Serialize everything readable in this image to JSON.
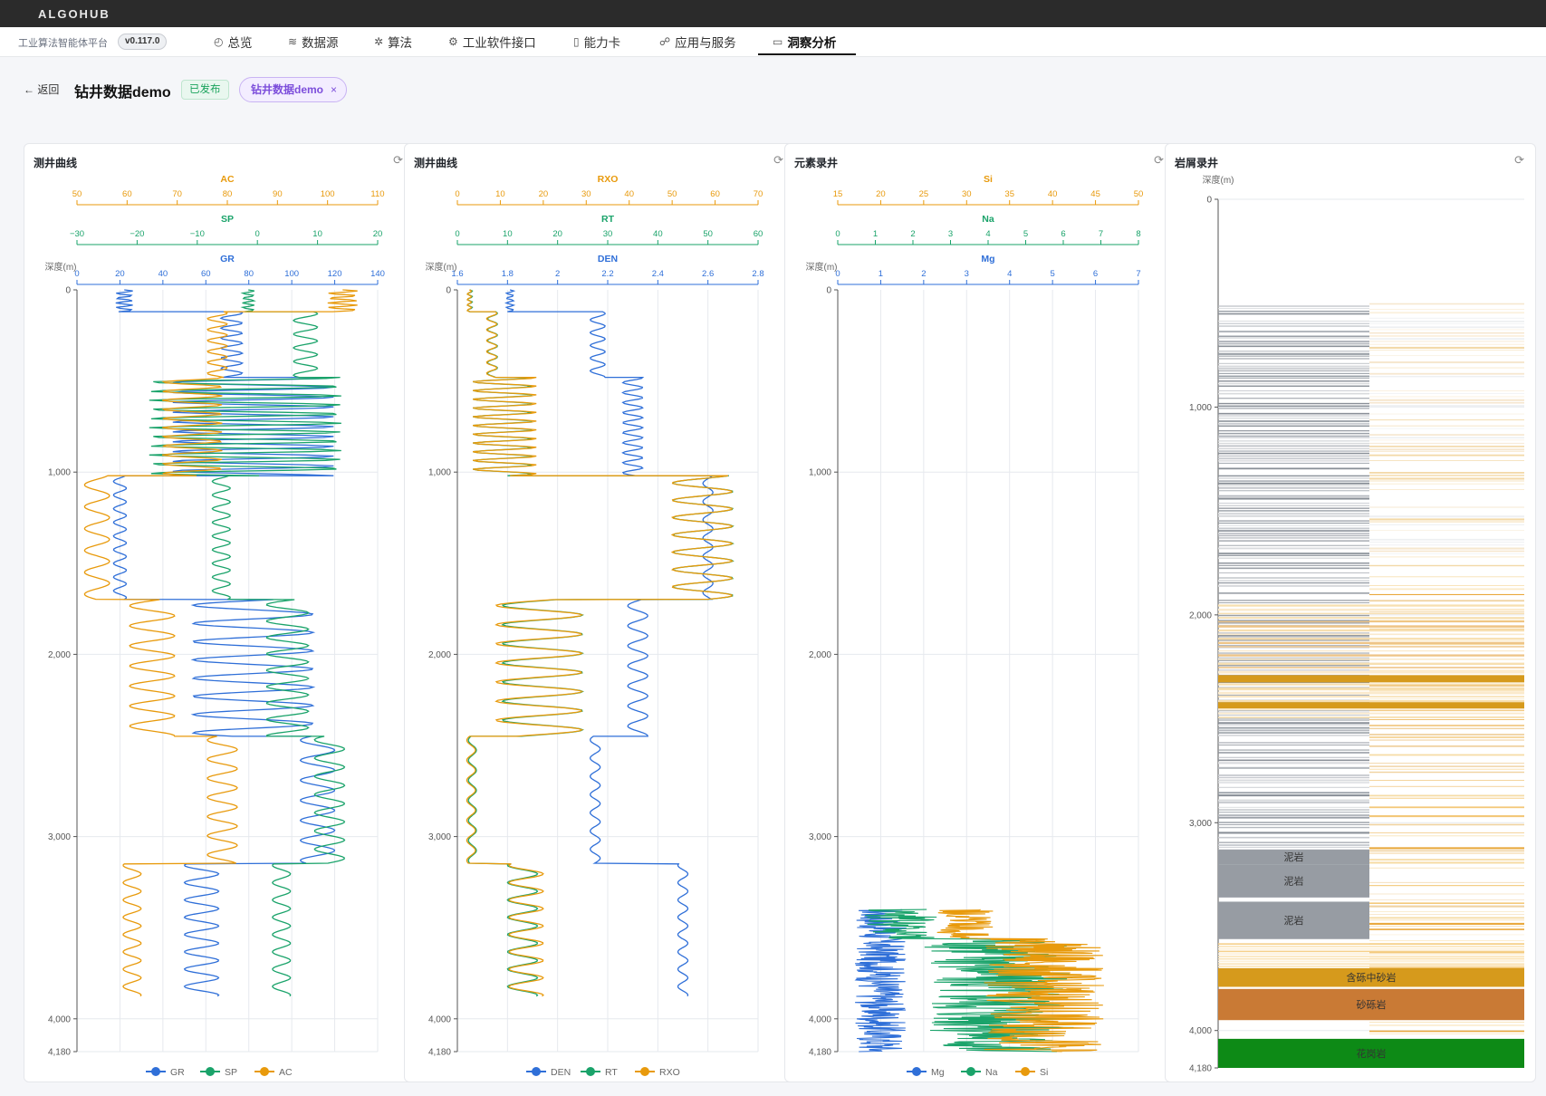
{
  "header": {
    "brand": "ALGOHUB"
  },
  "nav": {
    "platform": "工业算法智能体平台",
    "version": "v0.117.0",
    "items": [
      {
        "label": "总览",
        "icon": "dashboard-icon",
        "active": false
      },
      {
        "label": "数据源",
        "icon": "database-icon",
        "active": false
      },
      {
        "label": "算法",
        "icon": "sparkle-icon",
        "active": false
      },
      {
        "label": "工业软件接口",
        "icon": "chip-icon",
        "active": false
      },
      {
        "label": "能力卡",
        "icon": "card-icon",
        "active": false
      },
      {
        "label": "应用与服务",
        "icon": "service-icon",
        "active": false
      },
      {
        "label": "洞察分析",
        "icon": "insight-icon",
        "active": true
      }
    ]
  },
  "page": {
    "back_label": "← 返回",
    "title": "钻井数据demo",
    "status": "已发布",
    "tag": "钻井数据demo",
    "tag_close": "×"
  },
  "panels": {
    "p1": {
      "title": "测井曲线",
      "legend": [
        "GR",
        "SP",
        "AC"
      ]
    },
    "p2": {
      "title": "测井曲线",
      "legend": [
        "DEN",
        "RT",
        "RXO"
      ]
    },
    "p3": {
      "title": "元素录井",
      "legend": [
        "Mg",
        "Na",
        "Si"
      ]
    },
    "p4": {
      "title": "岩屑录井",
      "depth_label": "深度(m)"
    }
  },
  "colors": {
    "blue": "#2f6fd8",
    "green": "#1aa36a",
    "orange": "#e89a0c",
    "grid": "#e6e9ee"
  },
  "chart_data": [
    {
      "type": "line",
      "title": "测井曲线",
      "ylabel": "深度(m)",
      "ylim": [
        0,
        4180
      ],
      "ytick_labels": [
        "0",
        "1,000",
        "2,000",
        "3,000",
        "4,000",
        "4,180"
      ],
      "axes": [
        {
          "name": "AC",
          "color": "#e89a0c",
          "range": [
            50,
            110
          ],
          "tick_labels": [
            "50",
            "60",
            "70",
            "80",
            "90",
            "100",
            "110"
          ]
        },
        {
          "name": "SP",
          "color": "#1aa36a",
          "range": [
            -30,
            20
          ],
          "tick_labels": [
            "−30",
            "−20",
            "−10",
            "0",
            "10",
            "20"
          ]
        },
        {
          "name": "GR",
          "color": "#2f6fd8",
          "range": [
            0,
            140
          ],
          "tick_labels": [
            "0",
            "20",
            "40",
            "60",
            "80",
            "100",
            "120",
            "140"
          ]
        }
      ],
      "series": [
        {
          "name": "GR",
          "color": "#2f6fd8",
          "axis": 2,
          "segments": [
            {
              "d0": 0,
              "d1": 120,
              "base": 22,
              "amp": 4,
              "period": 26
            },
            {
              "d0": 120,
              "d1": 480,
              "base": 72,
              "amp": 5,
              "period": 55
            },
            {
              "d0": 480,
              "d1": 1020,
              "base": 82,
              "amp": 38,
              "period": 54
            },
            {
              "d0": 1020,
              "d1": 1700,
              "base": 20,
              "amp": 3,
              "period": 75
            },
            {
              "d0": 1700,
              "d1": 2450,
              "base": 82,
              "amp": 28,
              "period": 100
            },
            {
              "d0": 2450,
              "d1": 3150,
              "base": 112,
              "amp": 8,
              "period": 110
            },
            {
              "d0": 3150,
              "d1": 3880,
              "base": 58,
              "amp": 8,
              "period": 95
            }
          ]
        },
        {
          "name": "SP",
          "color": "#1aa36a",
          "axis": 1,
          "segments": [
            {
              "d0": 0,
              "d1": 120,
              "base": -1.5,
              "amp": 1,
              "period": 26
            },
            {
              "d0": 120,
              "d1": 480,
              "base": 8,
              "amp": 2,
              "period": 75
            },
            {
              "d0": 480,
              "d1": 1020,
              "base": -2,
              "amp": 16,
              "period": 50
            },
            {
              "d0": 1020,
              "d1": 1700,
              "base": -6,
              "amp": 1.5,
              "period": 75
            },
            {
              "d0": 1700,
              "d1": 2450,
              "base": 5,
              "amp": 3.5,
              "period": 90
            },
            {
              "d0": 2450,
              "d1": 3150,
              "base": 12,
              "amp": 2.5,
              "period": 100
            },
            {
              "d0": 3150,
              "d1": 3880,
              "base": 4,
              "amp": 1.5,
              "period": 95
            }
          ]
        },
        {
          "name": "AC",
          "color": "#e89a0c",
          "axis": 0,
          "segments": [
            {
              "d0": 0,
              "d1": 120,
              "base": 103,
              "amp": 3,
              "period": 26
            },
            {
              "d0": 120,
              "d1": 480,
              "base": 78,
              "amp": 2,
              "period": 60
            },
            {
              "d0": 480,
              "d1": 1020,
              "base": 73,
              "amp": 6,
              "period": 50
            },
            {
              "d0": 1020,
              "d1": 1700,
              "base": 54,
              "amp": 2.5,
              "period": 120
            },
            {
              "d0": 1700,
              "d1": 2450,
              "base": 65,
              "amp": 4.5,
              "period": 110
            },
            {
              "d0": 2450,
              "d1": 3150,
              "base": 79,
              "amp": 3,
              "period": 105
            },
            {
              "d0": 3150,
              "d1": 3880,
              "base": 61,
              "amp": 1.8,
              "period": 95
            }
          ]
        }
      ]
    },
    {
      "type": "line",
      "title": "测井曲线",
      "ylabel": "深度(m)",
      "ylim": [
        0,
        4180
      ],
      "ytick_labels": [
        "0",
        "1,000",
        "2,000",
        "3,000",
        "4,000",
        "4,180"
      ],
      "axes": [
        {
          "name": "RXO",
          "color": "#e89a0c",
          "range": [
            0,
            70
          ],
          "tick_labels": [
            "0",
            "10",
            "20",
            "30",
            "40",
            "50",
            "60",
            "70"
          ]
        },
        {
          "name": "RT",
          "color": "#1aa36a",
          "range": [
            0,
            60
          ],
          "tick_labels": [
            "0",
            "10",
            "20",
            "30",
            "40",
            "50",
            "60"
          ]
        },
        {
          "name": "DEN",
          "color": "#2f6fd8",
          "range": [
            1.6,
            2.8
          ],
          "tick_labels": [
            "1.6",
            "1.8",
            "2",
            "2.2",
            "2.4",
            "2.6",
            "2.8"
          ]
        }
      ],
      "series": [
        {
          "name": "DEN",
          "color": "#2f6fd8",
          "axis": 2,
          "segments": [
            {
              "d0": 0,
              "d1": 120,
              "base": 1.81,
              "amp": 0.015,
              "period": 26
            },
            {
              "d0": 120,
              "d1": 480,
              "base": 2.16,
              "amp": 0.03,
              "period": 70
            },
            {
              "d0": 480,
              "d1": 1020,
              "base": 2.3,
              "amp": 0.04,
              "period": 55
            },
            {
              "d0": 1020,
              "d1": 1700,
              "base": 2.6,
              "amp": 0.02,
              "period": 100
            },
            {
              "d0": 1700,
              "d1": 2450,
              "base": 2.32,
              "amp": 0.04,
              "period": 110
            },
            {
              "d0": 2450,
              "d1": 3150,
              "base": 2.15,
              "amp": 0.02,
              "period": 100
            },
            {
              "d0": 3150,
              "d1": 3880,
              "base": 2.5,
              "amp": 0.02,
              "period": 95
            }
          ]
        },
        {
          "name": "RT",
          "color": "#1aa36a",
          "axis": 1,
          "segments": [
            {
              "d0": 0,
              "d1": 120,
              "base": 2.5,
              "amp": 0.5,
              "period": 30
            },
            {
              "d0": 120,
              "d1": 480,
              "base": 7,
              "amp": 1,
              "period": 60
            },
            {
              "d0": 480,
              "d1": 1020,
              "base": 9,
              "amp": 6,
              "period": 48
            },
            {
              "d0": 1020,
              "d1": 1700,
              "base": 49,
              "amp": 6,
              "period": 95
            },
            {
              "d0": 1700,
              "d1": 2450,
              "base": 17,
              "amp": 8,
              "period": 105
            },
            {
              "d0": 2450,
              "d1": 3150,
              "base": 3,
              "amp": 0.8,
              "period": 110
            },
            {
              "d0": 3150,
              "d1": 3880,
              "base": 13,
              "amp": 3,
              "period": 95
            }
          ]
        },
        {
          "name": "RXO",
          "color": "#e89a0c",
          "axis": 0,
          "segments": [
            {
              "d0": 0,
              "d1": 120,
              "base": 2.8,
              "amp": 0.5,
              "period": 30
            },
            {
              "d0": 120,
              "d1": 480,
              "base": 8,
              "amp": 1.2,
              "period": 60
            },
            {
              "d0": 480,
              "d1": 1020,
              "base": 11,
              "amp": 7.5,
              "period": 48
            },
            {
              "d0": 1020,
              "d1": 1700,
              "base": 57,
              "amp": 7,
              "period": 95
            },
            {
              "d0": 1700,
              "d1": 2450,
              "base": 19,
              "amp": 10,
              "period": 105
            },
            {
              "d0": 2450,
              "d1": 3150,
              "base": 3.2,
              "amp": 1,
              "period": 110
            },
            {
              "d0": 3150,
              "d1": 3880,
              "base": 16,
              "amp": 4,
              "period": 95
            }
          ]
        }
      ]
    },
    {
      "type": "line",
      "title": "元素录井",
      "ylabel": "深度(m)",
      "ylim": [
        0,
        4180
      ],
      "ytick_labels": [
        "0",
        "1,000",
        "2,000",
        "3,000",
        "4,000",
        "4,180"
      ],
      "axes": [
        {
          "name": "Si",
          "color": "#e89a0c",
          "range": [
            15,
            50
          ],
          "tick_labels": [
            "15",
            "20",
            "25",
            "30",
            "35",
            "40",
            "45",
            "50"
          ]
        },
        {
          "name": "Na",
          "color": "#1aa36a",
          "range": [
            0,
            8
          ],
          "tick_labels": [
            "0",
            "1",
            "2",
            "3",
            "4",
            "5",
            "6",
            "7",
            "8"
          ]
        },
        {
          "name": "Mg",
          "color": "#2f6fd8",
          "range": [
            0,
            7
          ],
          "tick_labels": [
            "0",
            "1",
            "2",
            "3",
            "4",
            "5",
            "6",
            "7"
          ]
        }
      ],
      "series": [
        {
          "name": "Mg",
          "color": "#2f6fd8",
          "axis": 2,
          "depth_range": [
            3400,
            4180
          ],
          "center": 1.0,
          "spread": 0.6
        },
        {
          "name": "Na",
          "color": "#1aa36a",
          "axis": 1,
          "depth_range": [
            3400,
            4180
          ],
          "center": 4.3,
          "spread": 2.0
        },
        {
          "name": "Si",
          "color": "#e89a0c",
          "axis": 0,
          "depth_range": [
            3400,
            4180
          ],
          "center": 39,
          "spread": 7
        }
      ]
    },
    {
      "type": "bar",
      "title": "岩屑录井",
      "ylabel": "深度(m)",
      "ylim": [
        0,
        4180
      ],
      "ytick_labels": [
        "0",
        "1,000",
        "2,000",
        "3,000",
        "4,000",
        "4,180"
      ],
      "intervals": [
        {
          "top": 3130,
          "base": 3200,
          "lith": "泥岩",
          "color": "#979ca3"
        },
        {
          "top": 3200,
          "base": 3360,
          "lith": "泥岩",
          "color": "#979ca3"
        },
        {
          "top": 3380,
          "base": 3560,
          "lith": "泥岩",
          "color": "#979ca3"
        },
        {
          "top": 3700,
          "base": 3790,
          "lith": "含砾中砂岩",
          "color": "#d69a1c"
        },
        {
          "top": 3800,
          "base": 3950,
          "lith": "砂砾岩",
          "color": "#c97a35"
        },
        {
          "top": 4040,
          "base": 4180,
          "lith": "花岗岩",
          "color": "#0d8a16"
        }
      ]
    }
  ]
}
